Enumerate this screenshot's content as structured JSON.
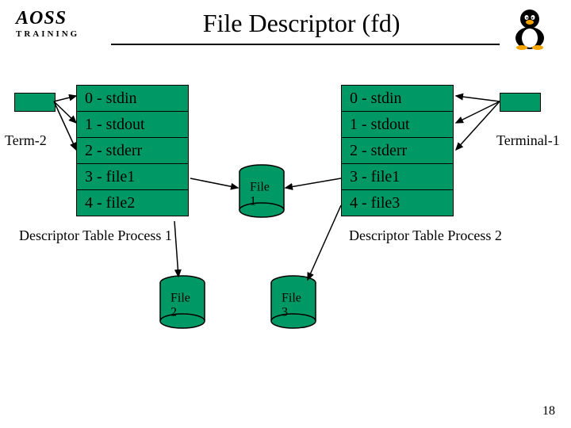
{
  "header": {
    "logo_main": "AOSS",
    "logo_sub": "TRAINING",
    "title": "File Descriptor (fd)"
  },
  "left_table": {
    "rows": [
      "0 - stdin",
      "1 - stdout",
      "2 - stderr",
      "3 - file1",
      "4 - file2"
    ],
    "caption": "Descriptor Table Process 1"
  },
  "right_table": {
    "rows": [
      "0 - stdin",
      "1 - stdout",
      "2 - stderr",
      "3 - file1",
      "4 - file3"
    ],
    "caption": "Descriptor Table Process 2"
  },
  "terminals": {
    "left": "Term-2",
    "right": "Terminal-1"
  },
  "files": {
    "f1": "File 1",
    "f2": "File 2",
    "f3": "File 3"
  },
  "slide_number": "18"
}
